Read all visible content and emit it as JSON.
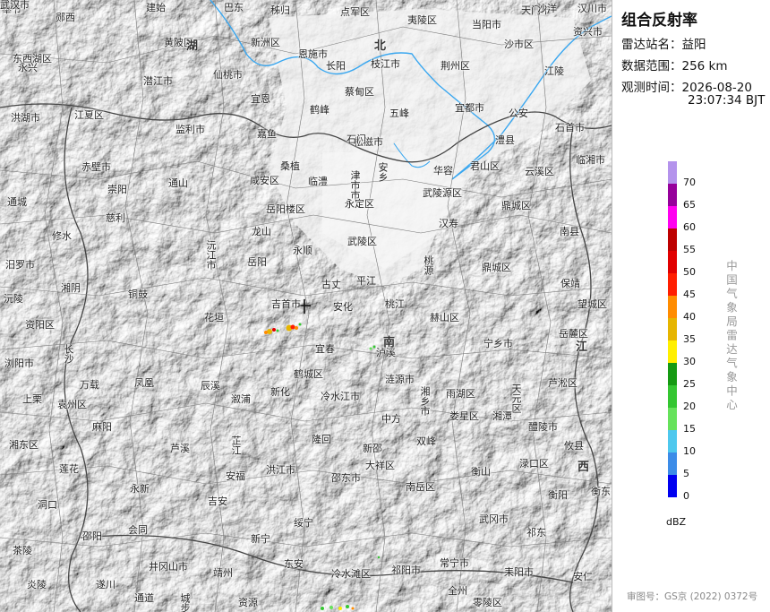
{
  "panel": {
    "title": "组合反射率",
    "station_label": "雷达站名：",
    "station_value": "益阳",
    "range_label": "数据范围：",
    "range_value": "256 km",
    "time_label": "观测时间：",
    "time_date": "2026-08-20",
    "time_clock": "23:07:34 BJT",
    "unit": "dBZ",
    "agency": "中国气象局雷达气象中心",
    "approval": "审图号：GS京 (2022) 0372号"
  },
  "legend": [
    {
      "label": "0",
      "color": "#0000f0"
    },
    {
      "label": "5",
      "color": "#3c8ce8"
    },
    {
      "label": "10",
      "color": "#4ec8ee"
    },
    {
      "label": "15",
      "color": "#66e25b"
    },
    {
      "label": "20",
      "color": "#34c631"
    },
    {
      "label": "25",
      "color": "#159a12"
    },
    {
      "label": "30",
      "color": "#ffef00"
    },
    {
      "label": "35",
      "color": "#e6b500"
    },
    {
      "label": "40",
      "color": "#ff8c00"
    },
    {
      "label": "45",
      "color": "#ff1e00"
    },
    {
      "label": "50",
      "color": "#e10000"
    },
    {
      "label": "55",
      "color": "#bd0000"
    },
    {
      "label": "60",
      "color": "#ff00f0"
    },
    {
      "label": "65",
      "color": "#96009b"
    },
    {
      "label": "70",
      "color": "#b493ec"
    }
  ],
  "places": [
    "奉节",
    "郧西",
    "建始",
    "巴东",
    "秭归",
    "点军区",
    "夷陵区",
    "当阳市",
    "天门市",
    "沙洋",
    "汉川市",
    "东西湖区",
    "黄陂区",
    "新洲区",
    "恩施市",
    "长阳",
    "枝江市",
    "荆州区",
    "沙市区",
    "潜江市",
    "仙桃市",
    "蔡甸区",
    "五峰",
    "宜都市",
    "江陵",
    "洪湖市",
    "江夏区",
    "宜恩",
    "鹤峰",
    "松滋市",
    "公安",
    "监利市",
    "嘉鱼",
    "石门",
    "澧县",
    "石首市",
    "赤壁市",
    "咸安区",
    "桑植",
    "临澧",
    "津市市",
    "安乡",
    "华容",
    "君山区",
    "云溪区",
    "临湘市",
    "崇阳",
    "通山",
    "武陵源区",
    "慈利",
    "岳阳楼区",
    "永定区",
    "鼎城区",
    "南县",
    "通城",
    "修水",
    "龙山",
    "永顺",
    "武陵区",
    "汉寿",
    "沅江市",
    "岳阳",
    "桃源",
    "鼎城区",
    "汨罗市",
    "平江",
    "保靖",
    "湘阴",
    "铜鼓",
    "古丈",
    "沅陵",
    "资阳区",
    "花垣",
    "吉首市",
    "安化",
    "桃江",
    "赫山区",
    "望城区",
    "长沙",
    "宜春",
    "泸溪",
    "宁乡市",
    "岳麓区",
    "浏阳市",
    "万载",
    "凤凰",
    "辰溪",
    "溆浦",
    "新化",
    "冷水江市",
    "涟源市",
    "湘乡市",
    "雨湖区",
    "天元区",
    "芦淞区",
    "上栗",
    "袁州区",
    "麻阳",
    "鹤城区",
    "中方",
    "娄星区",
    "湘潭",
    "醴陵市",
    "湘东区",
    "芦溪",
    "芷江",
    "隆回",
    "新邵",
    "双峰",
    "衡山",
    "渌口区",
    "攸县",
    "莲花",
    "安福",
    "洪江市",
    "大祥区",
    "邵东市",
    "南岳区",
    "衡阳",
    "衡东",
    "永新",
    "吉安",
    "洞口",
    "邵阳",
    "会同",
    "绥宁",
    "武冈市",
    "祁东",
    "茶陵",
    "井冈山市",
    "靖州",
    "新宁",
    "东安",
    "冷水滩区",
    "祁阳市",
    "常宁市",
    "耒阳市",
    "安仁",
    "炎陵",
    "遂川",
    "通道",
    "城步",
    "资源",
    "全州",
    "零陵区",
    "永兴",
    "资兴市",
    "恩施市",
    "武汉"
  ],
  "regions": [
    "湖",
    "北",
    "南",
    "江",
    "西"
  ]
}
